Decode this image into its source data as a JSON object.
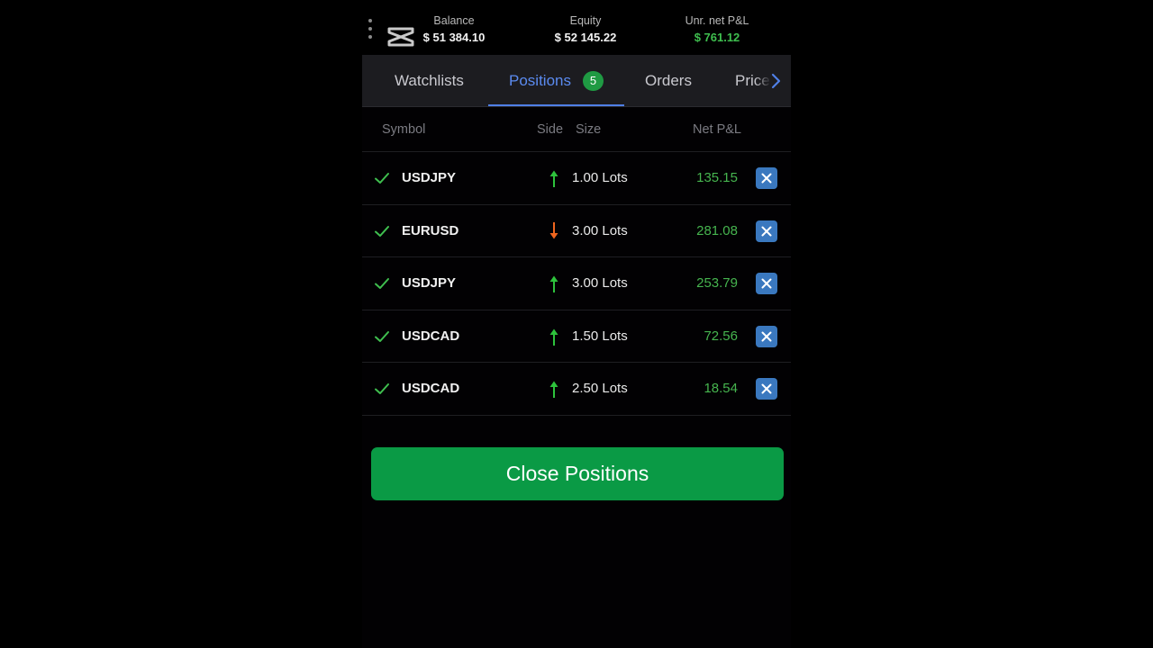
{
  "header": {
    "balance": {
      "label": "Balance",
      "value": "$ 51 384.10"
    },
    "equity": {
      "label": "Equity",
      "value": "$ 52 145.22"
    },
    "unrealized_pnl": {
      "label": "Unr. net P&L",
      "value": "$ 761.12",
      "color": "#3fbf4f"
    },
    "menu_icon": "vertical-dots-icon",
    "logo_icon": "capcut-logo"
  },
  "tabs": [
    {
      "label": "Watchlists",
      "active": false
    },
    {
      "label": "Positions",
      "active": true,
      "badge": "5"
    },
    {
      "label": "Orders",
      "active": false
    },
    {
      "label": "Prices",
      "active": false
    }
  ],
  "table": {
    "headers": {
      "symbol": "Symbol",
      "side": "Side",
      "size": "Size",
      "net_pnl": "Net P&L"
    },
    "rows": [
      {
        "symbol": "USDJPY",
        "side": "buy",
        "size": "1.00 Lots",
        "net_pnl": "135.15"
      },
      {
        "symbol": "EURUSD",
        "side": "sell",
        "size": "3.00 Lots",
        "net_pnl": "281.08"
      },
      {
        "symbol": "USDJPY",
        "side": "buy",
        "size": "3.00 Lots",
        "net_pnl": "253.79"
      },
      {
        "symbol": "USDCAD",
        "side": "buy",
        "size": "1.50 Lots",
        "net_pnl": "72.56"
      },
      {
        "symbol": "USDCAD",
        "side": "buy",
        "size": "2.50 Lots",
        "net_pnl": "18.54"
      }
    ]
  },
  "colors": {
    "buy_arrow": "#2ec23c",
    "sell_arrow": "#f0651e",
    "pnl_positive": "#46b54f",
    "accent": "#4f7fe6",
    "close_button": "#0a9a45",
    "row_close_button": "#3a78bf"
  },
  "close_positions_label": "Close Positions"
}
